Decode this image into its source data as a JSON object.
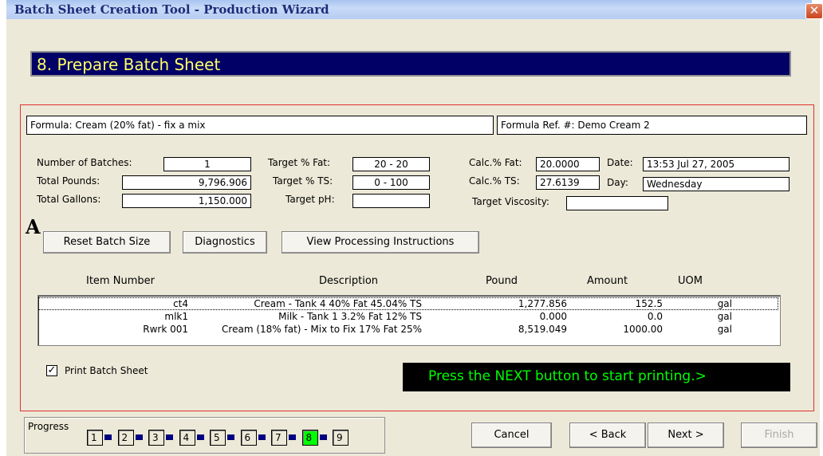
{
  "window": {
    "title": "Batch Sheet Creation Tool - Production Wizard",
    "close_glyph": "✕"
  },
  "step_banner": "8. Prepare Batch Sheet",
  "formula": {
    "name": "Formula: Cream (20% fat) - fix a mix",
    "ref": "Formula Ref. #:  Demo Cream 2"
  },
  "fields": {
    "num_batches_label": "Number of Batches:",
    "num_batches": "1",
    "total_pounds_label": "Total Pounds:",
    "total_pounds": "9,796.906",
    "total_gallons_label": "Total Gallons:",
    "total_gallons": "1,150.000",
    "target_fat_label": "Target % Fat:",
    "target_fat": "20 - 20",
    "target_ts_label": "Target % TS:",
    "target_ts": "0 - 100",
    "target_ph_label": "Target pH:",
    "target_ph": "",
    "calc_fat_label": "Calc.% Fat:",
    "calc_fat": "20.0000",
    "calc_ts_label": "Calc.% TS:",
    "calc_ts": "27.6139",
    "target_visc_label": "Target Viscosity:",
    "target_visc": "",
    "date_label": "Date:",
    "date": "13:53 Jul 27, 2005",
    "day_label": "Day:",
    "day": "Wednesday"
  },
  "marker": "A",
  "buttons": {
    "reset": "Reset Batch Size",
    "diagnostics": "Diagnostics",
    "processing": "View Processing Instructions"
  },
  "table": {
    "headers": [
      "Item Number",
      "Description",
      "Pound",
      "Amount",
      "UOM"
    ],
    "rows": [
      [
        "ct4",
        "Cream - Tank 4 40% Fat 45.04% TS",
        "1,277.856",
        "152.5",
        "gal"
      ],
      [
        "mlk1",
        "Milk - Tank 1 3.2% Fat 12% TS",
        "0.000",
        "0.0",
        "gal"
      ],
      [
        "Rwrk 001",
        "Cream (18% fat) - Mix to Fix 17% Fat 25%",
        "8,519.049",
        "1000.00",
        "gal"
      ]
    ]
  },
  "print_batch_sheet": {
    "label": "Print Batch Sheet",
    "checked": true,
    "check_glyph": "✓"
  },
  "message": "Press the NEXT button to start printing.>",
  "progress": {
    "label": "Progress",
    "steps": [
      "1",
      "2",
      "3",
      "4",
      "5",
      "6",
      "7",
      "8",
      "9"
    ],
    "current": 8
  },
  "nav": {
    "cancel": "Cancel",
    "back": "< Back",
    "next": "Next >",
    "finish": "Finish"
  }
}
